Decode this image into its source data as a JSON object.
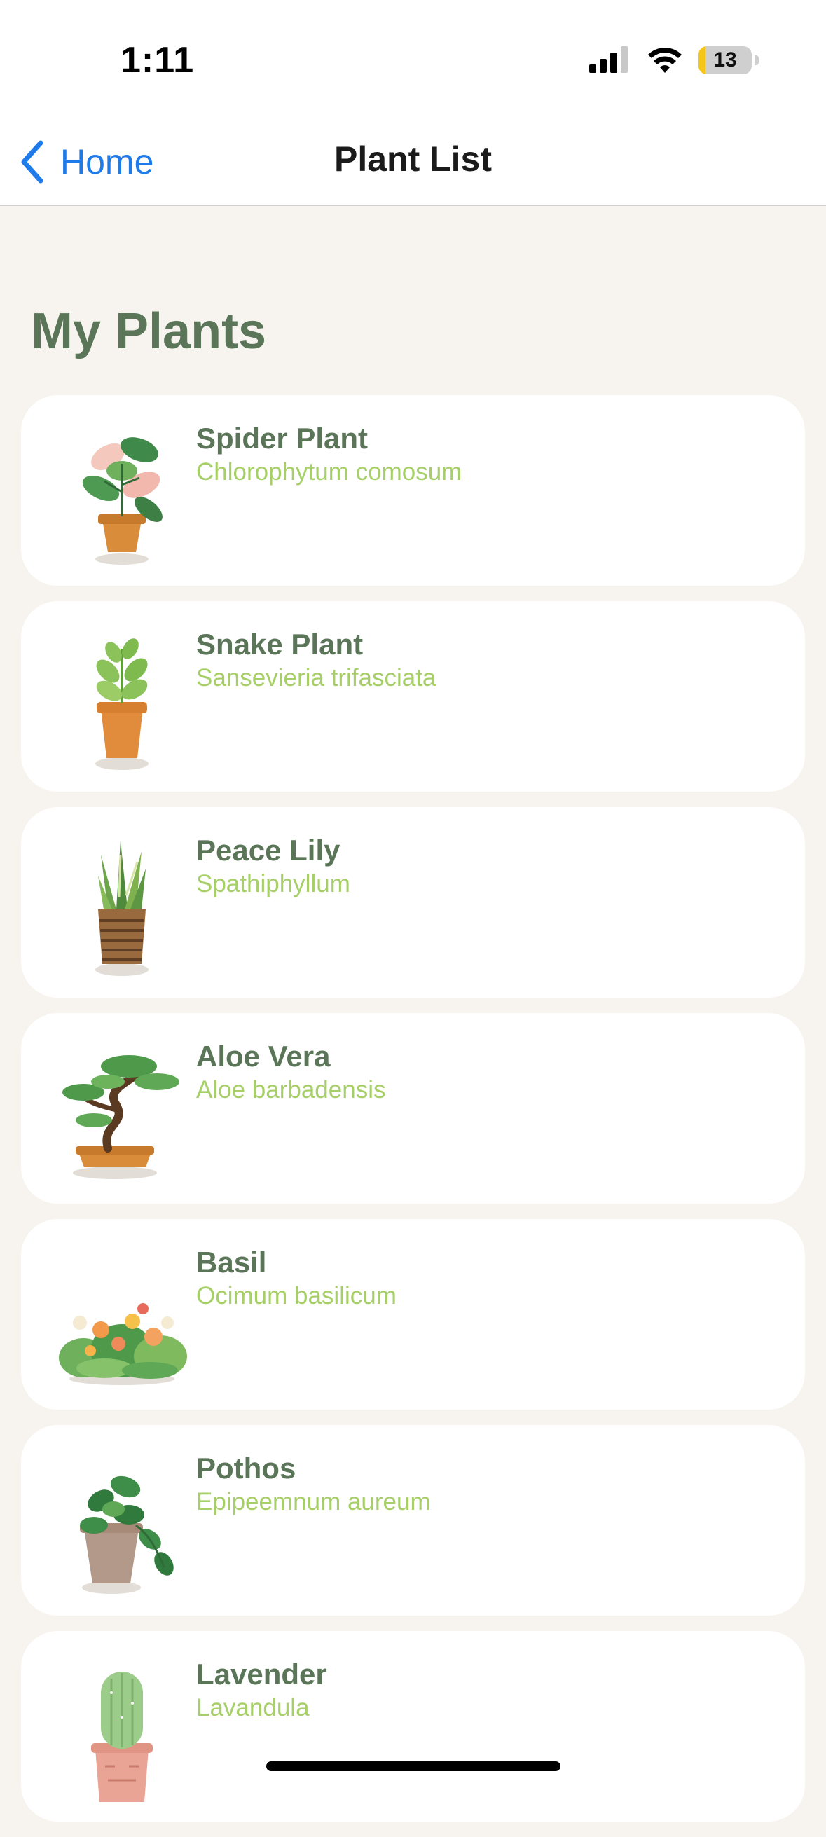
{
  "status_bar": {
    "time": "1:11",
    "battery": "13",
    "battery_color": "#f5c518"
  },
  "nav": {
    "back_label": "Home",
    "title": "Plant List"
  },
  "page": {
    "heading": "My Plants"
  },
  "plants": [
    {
      "name": "Spider Plant",
      "scientific": "Chlorophytum comosum",
      "icon": "variegated-plant-icon"
    },
    {
      "name": "Snake Plant",
      "scientific": "Sansevieria trifasciata",
      "icon": "sprout-pot-icon"
    },
    {
      "name": "Peace Lily",
      "scientific": "Spathiphyllum",
      "icon": "snake-plant-icon"
    },
    {
      "name": "Aloe Vera",
      "scientific": "Aloe barbadensis",
      "icon": "bonsai-icon"
    },
    {
      "name": "Basil",
      "scientific": "Ocimum basilicum",
      "icon": "flower-bush-icon"
    },
    {
      "name": "Pothos",
      "scientific": "Epipeemnum aureum",
      "icon": "pothos-icon"
    },
    {
      "name": "Lavender",
      "scientific": "Lavandula",
      "icon": "cactus-icon"
    }
  ],
  "colors": {
    "background": "#f7f3ee",
    "title_green": "#5a7558",
    "subtitle_green": "#a6cf68",
    "link_blue": "#1f7aea"
  }
}
